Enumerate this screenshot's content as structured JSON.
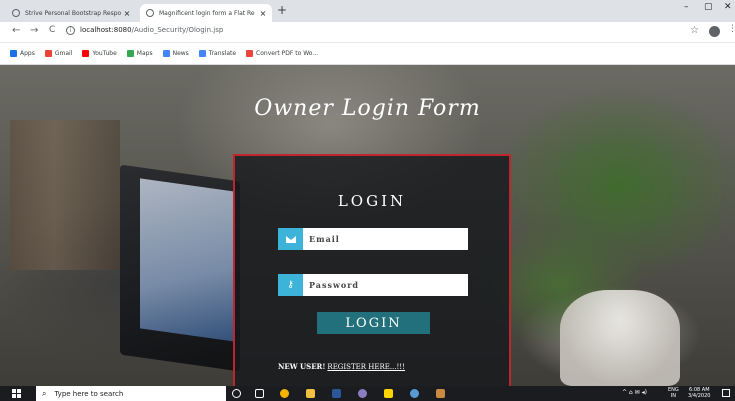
{
  "browser": {
    "tabs": [
      {
        "title": "Strive Personal Bootstrap Respo",
        "active": false
      },
      {
        "title": "Magnificent login form a Flat Re",
        "active": true
      }
    ],
    "new_tab": "+",
    "tab_close": "×",
    "window_controls": {
      "minimize": "–",
      "maximize": "▢",
      "close": "✕"
    },
    "nav": {
      "back": "←",
      "forward": "→",
      "reload": "C"
    },
    "address": {
      "host": "localhost:8080",
      "path": "/Audio_Security/Ologin.jsp"
    },
    "bookmarks": [
      {
        "label": "Apps",
        "color": "#1a73e8"
      },
      {
        "label": "Gmail",
        "color": "#ea4335"
      },
      {
        "label": "YouTube",
        "color": "#ff0000"
      },
      {
        "label": "Maps",
        "color": "#34a853"
      },
      {
        "label": "News",
        "color": "#4285f4"
      },
      {
        "label": "Translate",
        "color": "#4285f4"
      },
      {
        "label": "Convert PDF to Wo...",
        "color": "#e8453c"
      }
    ]
  },
  "page": {
    "title": "Owner Login Form",
    "login_heading": "LOGIN",
    "email_placeholder": "Email",
    "password_placeholder": "Password",
    "login_button": "LOGIN",
    "new_user_text": "NEW USER!",
    "register_link": "REGISTER HERE...!!!",
    "panel_border_color": "#c0242d",
    "accent_color": "#3db3d9",
    "button_color": "#21707b"
  },
  "taskbar": {
    "search_placeholder": "Type here to search",
    "tray_text": "^ ⌂ ✉ ◂)",
    "lang": "ENG",
    "region": "IN",
    "time": "6:08 AM",
    "date": "3/4/2020"
  }
}
